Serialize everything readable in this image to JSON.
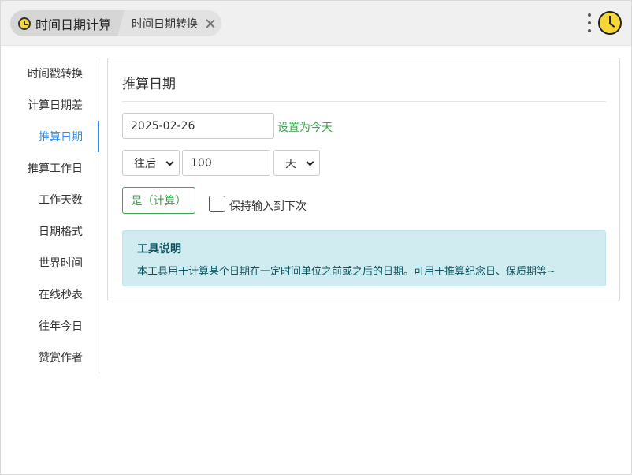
{
  "header": {
    "home_label": "时间日期计算",
    "tab_label": "时间日期转换"
  },
  "sidebar": {
    "items": [
      {
        "label": "时间戳转换"
      },
      {
        "label": "计算日期差"
      },
      {
        "label": "推算日期",
        "active": true
      },
      {
        "label": "推算工作日"
      },
      {
        "label": "工作天数"
      },
      {
        "label": "日期格式"
      },
      {
        "label": "世界时间"
      },
      {
        "label": "在线秒表"
      },
      {
        "label": "往年今日"
      },
      {
        "label": "赞赏作者"
      }
    ]
  },
  "main": {
    "title": "推算日期",
    "date_value": "2025-02-26",
    "set_today_label": "设置为今天",
    "direction_value": "往后",
    "amount_value": "100",
    "unit_value": "天",
    "calc_button_label": "是（计算）",
    "keep_input_label": "保持输入到下次",
    "keep_input_checked": false,
    "info": {
      "title": "工具说明",
      "text": "本工具用于计算某个日期在一定时间单位之前或之后的日期。可用于推算纪念日、保质期等~"
    }
  },
  "colors": {
    "accent_blue": "#2d8cf0",
    "accent_green": "#3aa54c",
    "info_bg": "#d1ecf1",
    "clock_yellow": "#f7d63a"
  },
  "icons": {
    "home": "clock-icon",
    "close": "close-icon",
    "menu": "more-vertical-icon",
    "app": "clock-icon"
  }
}
